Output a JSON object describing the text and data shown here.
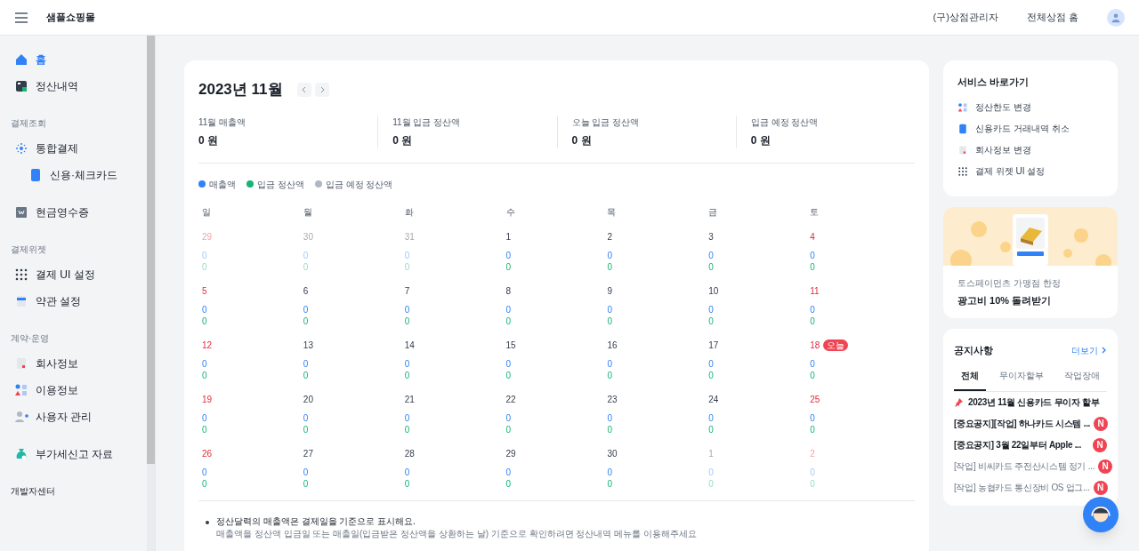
{
  "header": {
    "title": "샘플쇼핑몰",
    "links": [
      "(구)상점관리자",
      "전체상점 홈"
    ]
  },
  "sidebar": {
    "sections": [
      {
        "items": [
          {
            "label": "홈",
            "selected": true
          },
          {
            "label": "정산내역",
            "selected": false
          }
        ]
      },
      {
        "title": "결제조회",
        "items": [
          {
            "label": "통합결제",
            "selected": false,
            "children": [
              {
                "label": "신용·체크카드",
                "selected": false
              }
            ]
          }
        ]
      },
      {
        "items": [
          {
            "label": "현금영수증",
            "selected": false
          }
        ]
      },
      {
        "title": "결제위젯",
        "items": [
          {
            "label": "결제 UI 설정",
            "selected": false
          },
          {
            "label": "약관 설정",
            "selected": false
          }
        ]
      },
      {
        "title": "계약·운영",
        "items": [
          {
            "label": "회사정보",
            "selected": false
          },
          {
            "label": "이용정보",
            "selected": false
          },
          {
            "label": "사용자 관리",
            "selected": false
          }
        ]
      },
      {
        "items": [
          {
            "label": "부가세신고 자료",
            "selected": false
          }
        ]
      },
      {
        "title": "개발자센터"
      }
    ]
  },
  "calendar": {
    "title": "2023년 11월",
    "summary": [
      {
        "label": "11월 매출액",
        "value": "0 원"
      },
      {
        "label": "11월 입금 정산액",
        "value": "0 원"
      },
      {
        "label": "오늘 입금 정산액",
        "value": "0 원"
      },
      {
        "label": "입금 예정 정산액",
        "value": "0 원"
      }
    ],
    "legend": [
      {
        "label": "매출액",
        "color": "#3182f6"
      },
      {
        "label": "입금 정산액",
        "color": "#15b575"
      },
      {
        "label": "입금 예정 정산액",
        "color": "#b0b8c1"
      }
    ],
    "weekdays": [
      "일",
      "월",
      "화",
      "수",
      "목",
      "금",
      "토"
    ],
    "weeks": [
      [
        {
          "day": "29",
          "in_month": false,
          "values": [
            "0",
            "0"
          ]
        },
        {
          "day": "30",
          "in_month": false,
          "values": [
            "0",
            "0"
          ]
        },
        {
          "day": "31",
          "in_month": false,
          "values": [
            "0",
            "0"
          ]
        },
        {
          "day": "1",
          "in_month": true,
          "values": [
            "0",
            "0"
          ]
        },
        {
          "day": "2",
          "in_month": true,
          "values": [
            "0",
            "0"
          ]
        },
        {
          "day": "3",
          "in_month": true,
          "values": [
            "0",
            "0"
          ]
        },
        {
          "day": "4",
          "in_month": true,
          "values": [
            "0",
            "0"
          ]
        }
      ],
      [
        {
          "day": "5",
          "in_month": true,
          "values": [
            "0",
            "0"
          ]
        },
        {
          "day": "6",
          "in_month": true,
          "values": [
            "0",
            "0"
          ]
        },
        {
          "day": "7",
          "in_month": true,
          "values": [
            "0",
            "0"
          ]
        },
        {
          "day": "8",
          "in_month": true,
          "values": [
            "0",
            "0"
          ]
        },
        {
          "day": "9",
          "in_month": true,
          "values": [
            "0",
            "0"
          ]
        },
        {
          "day": "10",
          "in_month": true,
          "values": [
            "0",
            "0"
          ]
        },
        {
          "day": "11",
          "in_month": true,
          "values": [
            "0",
            "0"
          ]
        }
      ],
      [
        {
          "day": "12",
          "in_month": true,
          "values": [
            "0",
            "0"
          ]
        },
        {
          "day": "13",
          "in_month": true,
          "values": [
            "0",
            "0"
          ]
        },
        {
          "day": "14",
          "in_month": true,
          "values": [
            "0",
            "0"
          ]
        },
        {
          "day": "15",
          "in_month": true,
          "values": [
            "0",
            "0"
          ]
        },
        {
          "day": "16",
          "in_month": true,
          "values": [
            "0",
            "0"
          ]
        },
        {
          "day": "17",
          "in_month": true,
          "values": [
            "0",
            "0"
          ]
        },
        {
          "day": "18",
          "in_month": true,
          "badge": "오늘",
          "values": [
            "0",
            "0"
          ]
        }
      ],
      [
        {
          "day": "19",
          "in_month": true,
          "values": [
            "0",
            "0"
          ]
        },
        {
          "day": "20",
          "in_month": true,
          "values": [
            "0",
            "0"
          ]
        },
        {
          "day": "21",
          "in_month": true,
          "values": [
            "0",
            "0"
          ]
        },
        {
          "day": "22",
          "in_month": true,
          "values": [
            "0",
            "0"
          ]
        },
        {
          "day": "23",
          "in_month": true,
          "values": [
            "0",
            "0"
          ]
        },
        {
          "day": "24",
          "in_month": true,
          "values": [
            "0",
            "0"
          ]
        },
        {
          "day": "25",
          "in_month": true,
          "values": [
            "0",
            "0"
          ]
        }
      ],
      [
        {
          "day": "26",
          "in_month": true,
          "values": [
            "0",
            "0"
          ]
        },
        {
          "day": "27",
          "in_month": true,
          "values": [
            "0",
            "0"
          ]
        },
        {
          "day": "28",
          "in_month": true,
          "values": [
            "0",
            "0"
          ]
        },
        {
          "day": "29",
          "in_month": true,
          "values": [
            "0",
            "0"
          ]
        },
        {
          "day": "30",
          "in_month": true,
          "values": [
            "0",
            "0"
          ]
        },
        {
          "day": "1",
          "in_month": false,
          "values": [
            "0",
            "0"
          ]
        },
        {
          "day": "2",
          "in_month": false,
          "values": [
            "0",
            "0"
          ]
        }
      ]
    ],
    "notes": [
      {
        "text": "정산달력의 매출액은 결제일을 기준으로 표시해요.",
        "detail": "매출액을 정산액 입금일 또는 매출일(입금받은 정산액을 상환하는 날) 기준으로 확인하려면 정산내역 메뉴를 이용해주세요"
      }
    ]
  },
  "shortcuts": {
    "title": "서비스 바로가기",
    "items": [
      "정산한도 변경",
      "신용카드 거래내역 취소",
      "회사정보 변경",
      "결제 위젯 UI 설정"
    ]
  },
  "promo": {
    "subtitle": "토스페이먼츠 가맹점 한정",
    "title": "광고비 10% 돌려받기"
  },
  "notices": {
    "title": "공지사항",
    "more": "더보기",
    "tabs": [
      {
        "label": "전체",
        "selected": true
      },
      {
        "label": "무이자할부",
        "selected": false
      },
      {
        "label": "작업장애",
        "selected": false
      }
    ],
    "items": [
      {
        "text": "2023년 11월 신용카드 무이자 할부",
        "pinned": true,
        "bold": true
      },
      {
        "text": "[중요공지][작업] 하나카드 시스템 ...",
        "pinned": false,
        "bold": true,
        "badge": "N"
      },
      {
        "text": "[중요공지] 3월 22일부터 Apple ...",
        "pinned": false,
        "bold": true,
        "badge": "N"
      },
      {
        "text": "[작업] 비씨카드 주전산시스템 정기 ...",
        "pinned": false,
        "bold": false,
        "badge": "N"
      },
      {
        "text": "[작업] 농협카드 통신장비 OS 업그...",
        "pinned": false,
        "bold": false,
        "badge": "N"
      }
    ]
  }
}
